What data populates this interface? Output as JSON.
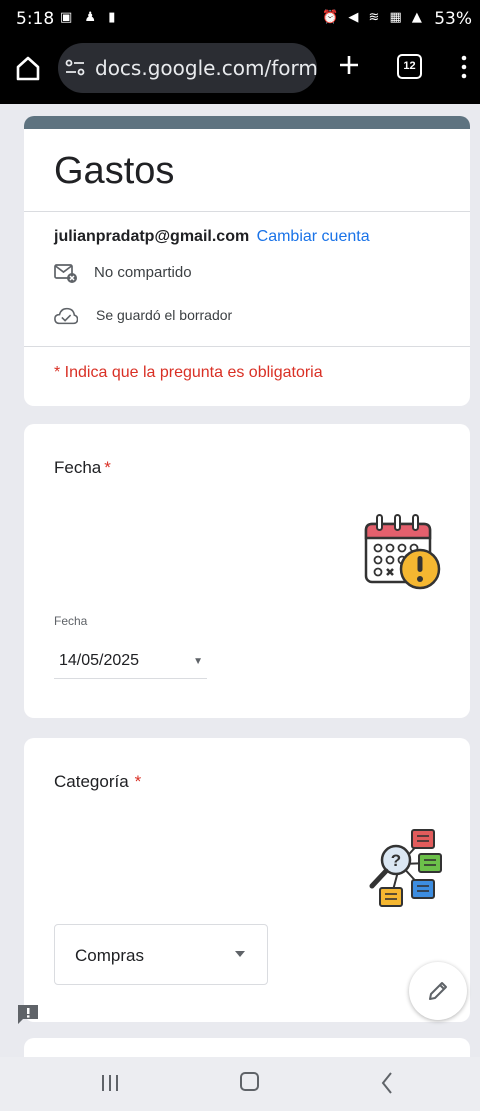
{
  "status_bar": {
    "time": "5:18",
    "battery": "53%"
  },
  "browser": {
    "url": "docs.google.com/forms",
    "tab_count": "12"
  },
  "form": {
    "title": "Gastos",
    "account_email": "julianpradatp@gmail.com",
    "switch_account": "Cambiar cuenta",
    "not_shared": "No compartido",
    "draft_saved": "Se guardó el borrador",
    "required_note": "* Indica que la pregunta es obligatoria",
    "accent_color": "#5e7380",
    "required_color": "#d93025",
    "link_color": "#1a73e8"
  },
  "questions": [
    {
      "title": "Fecha",
      "required_marker": "*",
      "illustration": "calendar-alert-icon",
      "field_label": "Fecha",
      "value": "14/05/2025"
    },
    {
      "title": "Categoría",
      "required_marker": "*",
      "illustration": "category-search-icon",
      "selected_option": "Compras"
    }
  ],
  "icons": {
    "home": "home-icon",
    "site_info": "tune-icon",
    "new_tab": "plus-icon",
    "menu": "more-vert-icon",
    "not_shared": "mail-off-icon",
    "draft_saved": "cloud-done-icon",
    "edit": "pencil-icon",
    "feedback": "feedback-icon"
  }
}
